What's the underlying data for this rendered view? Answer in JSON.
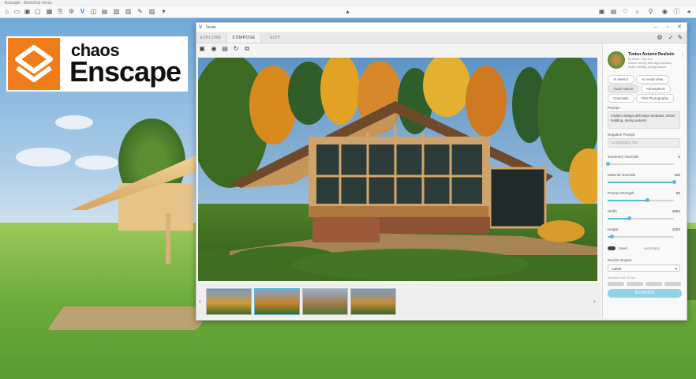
{
  "app": {
    "title": "Enscape · SketchUp Veras",
    "toolbar_icons": [
      "home-icon",
      "folder-icon",
      "save-icon",
      "screen-icon",
      "grid-icon",
      "veras-icon",
      "camera-icon",
      "image-icon",
      "share-icon",
      "settings-icon",
      "brush-icon",
      "sun-icon",
      "render-icon",
      "user-icon",
      "eye-icon",
      "info-icon",
      "layers-icon",
      "arrow-left-icon"
    ]
  },
  "logo": {
    "brand_small": "chaos",
    "brand_large": "Enscape",
    "accent": "#f07d1a"
  },
  "window": {
    "title": "Veras",
    "tabs": [
      {
        "label": "EXPLORE"
      },
      {
        "label": "COMPOSE"
      },
      {
        "label": "EDIT"
      }
    ],
    "active_tab": "COMPOSE"
  },
  "panel": {
    "preset": {
      "name": "Timber Autumn Realistic",
      "sub1": "by Veras · Sky 16:9",
      "sub2": "modern design with large windows",
      "sub3": "timber building, during autumn"
    },
    "chips": [
      {
        "label": "Is Interior",
        "selected": false
      },
      {
        "label": "Is Aerial View",
        "selected": false
      },
      {
        "label": "Tudor Nature",
        "selected": true
      },
      {
        "label": "Atmospheric",
        "selected": false
      },
      {
        "label": "Cinematic",
        "selected": false
      },
      {
        "label": "Film Photography",
        "selected": false
      }
    ],
    "prompt_label": "Prompt",
    "prompt_value": "modern design with large windows, timber building, during autumn",
    "negative_prompt_label": "Negative Prompt",
    "negative_prompt_placeholder": "not lightspire, film",
    "sliders": [
      {
        "label": "Geometry Override",
        "value": "0",
        "fraction": 0.0
      },
      {
        "label": "Material Override",
        "value": "100",
        "fraction": 1.0
      },
      {
        "label": "Prompt Strength",
        "value": "60",
        "fraction": 0.6
      },
      {
        "label": "Width",
        "value": "1824",
        "fraction": 0.32
      },
      {
        "label": "Height",
        "value": "1024",
        "fraction": 0.06
      }
    ],
    "seed_label": "Seed",
    "seed_value": "automatic",
    "render_engine_label": "Render Engine",
    "render_engine_value": "Latest",
    "renders_label": "Renders From 28 Jan",
    "render_button": "RENDER",
    "accent": "#5fb7d7"
  }
}
